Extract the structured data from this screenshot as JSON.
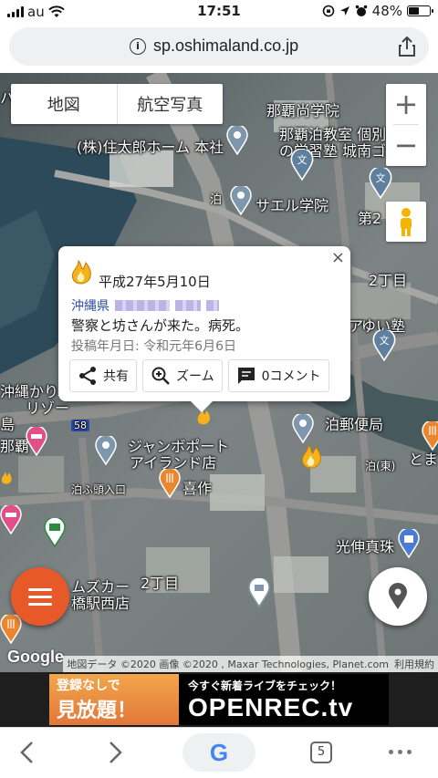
{
  "status": {
    "carrier": "au",
    "time": "17:51",
    "battery": "48%",
    "battery_level": 0.48
  },
  "browser": {
    "url": "sp.oshimaland.co.jp",
    "google_button": "G",
    "tab_count": "5"
  },
  "map": {
    "type_buttons": {
      "map": "地図",
      "satellite": "航空写真"
    },
    "zoom_in": "+",
    "zoom_out": "−",
    "labels": {
      "l1": "那覇尚学院",
      "l2": "(株)住太郎ホーム 本社",
      "l3": "那覇泊教室 個別",
      "l4": "の学習塾 城南ゴ",
      "l5": "泊",
      "l6": "サエル学院",
      "l7": "第2",
      "l8": "2丁目",
      "l9": "ゆい塾",
      "l10": "沖縄かり",
      "l11": "リゾー",
      "l12": "泊郵便局",
      "l13": "ジャンボポート",
      "l14": "アイランド店",
      "l15": "喜作",
      "l16": "泊ふ頭入口",
      "l17": "泊(東)",
      "l18": "光伸真珠",
      "l19": "2丁目",
      "l20": "ムズカー",
      "l21": "橋駅西店",
      "l22": "島",
      "l23": "那覇",
      "l24": "58",
      "l25": "とま",
      "l26": "ア",
      "l27": "ハ"
    },
    "google": "Google",
    "attribution": "地図データ ©2020 画像 ©2020 , Maxar Technologies, Planet.com",
    "terms": "利用規約"
  },
  "popup": {
    "close": "×",
    "date": "平成27年5月10日",
    "prefecture": "沖縄県",
    "body": "警察と坊さんが来た。病死。",
    "posted": "投稿年月日: 令和元年6月6日",
    "share": "共有",
    "zoom": "ズーム",
    "comments": "0コメント"
  },
  "banner": {
    "line1": "登録なしで",
    "line2": "見放題！",
    "line3": "今すぐ新着ライブをチェック！",
    "brand": "OPENREC.tv"
  },
  "colors": {
    "accent": "#e8592a",
    "link": "#2a4aa8"
  }
}
